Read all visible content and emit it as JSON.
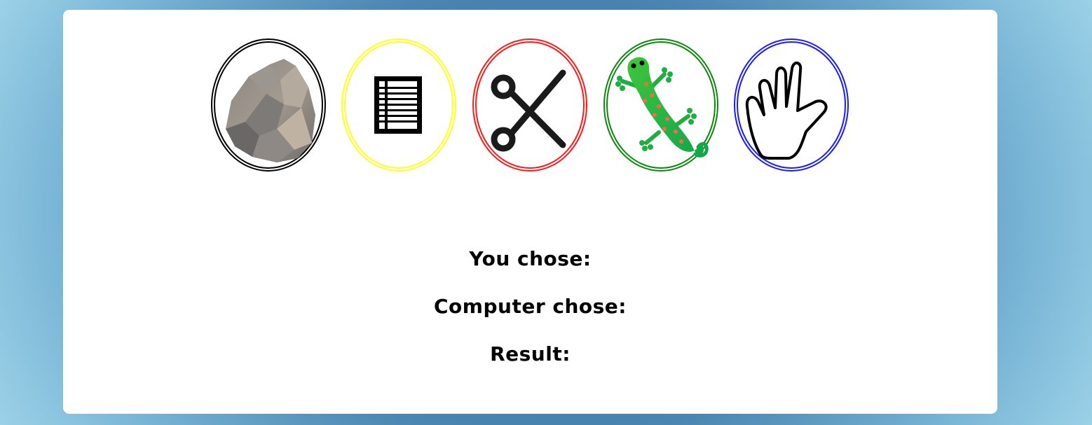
{
  "choices": [
    {
      "id": "rock",
      "icon": "rock-icon",
      "ring_color": "#000000"
    },
    {
      "id": "paper",
      "icon": "paper-icon",
      "ring_color": "#ffff22"
    },
    {
      "id": "scissors",
      "icon": "scissors-icon",
      "ring_color": "#ff1a1a"
    },
    {
      "id": "lizard",
      "icon": "lizard-icon",
      "ring_color": "#0a8a0a"
    },
    {
      "id": "spock",
      "icon": "spock-hand-icon",
      "ring_color": "#1a1aff"
    }
  ],
  "results": {
    "you_chose_label": "You chose:",
    "computer_chose_label": "Computer chose:",
    "result_label": "Result:"
  }
}
